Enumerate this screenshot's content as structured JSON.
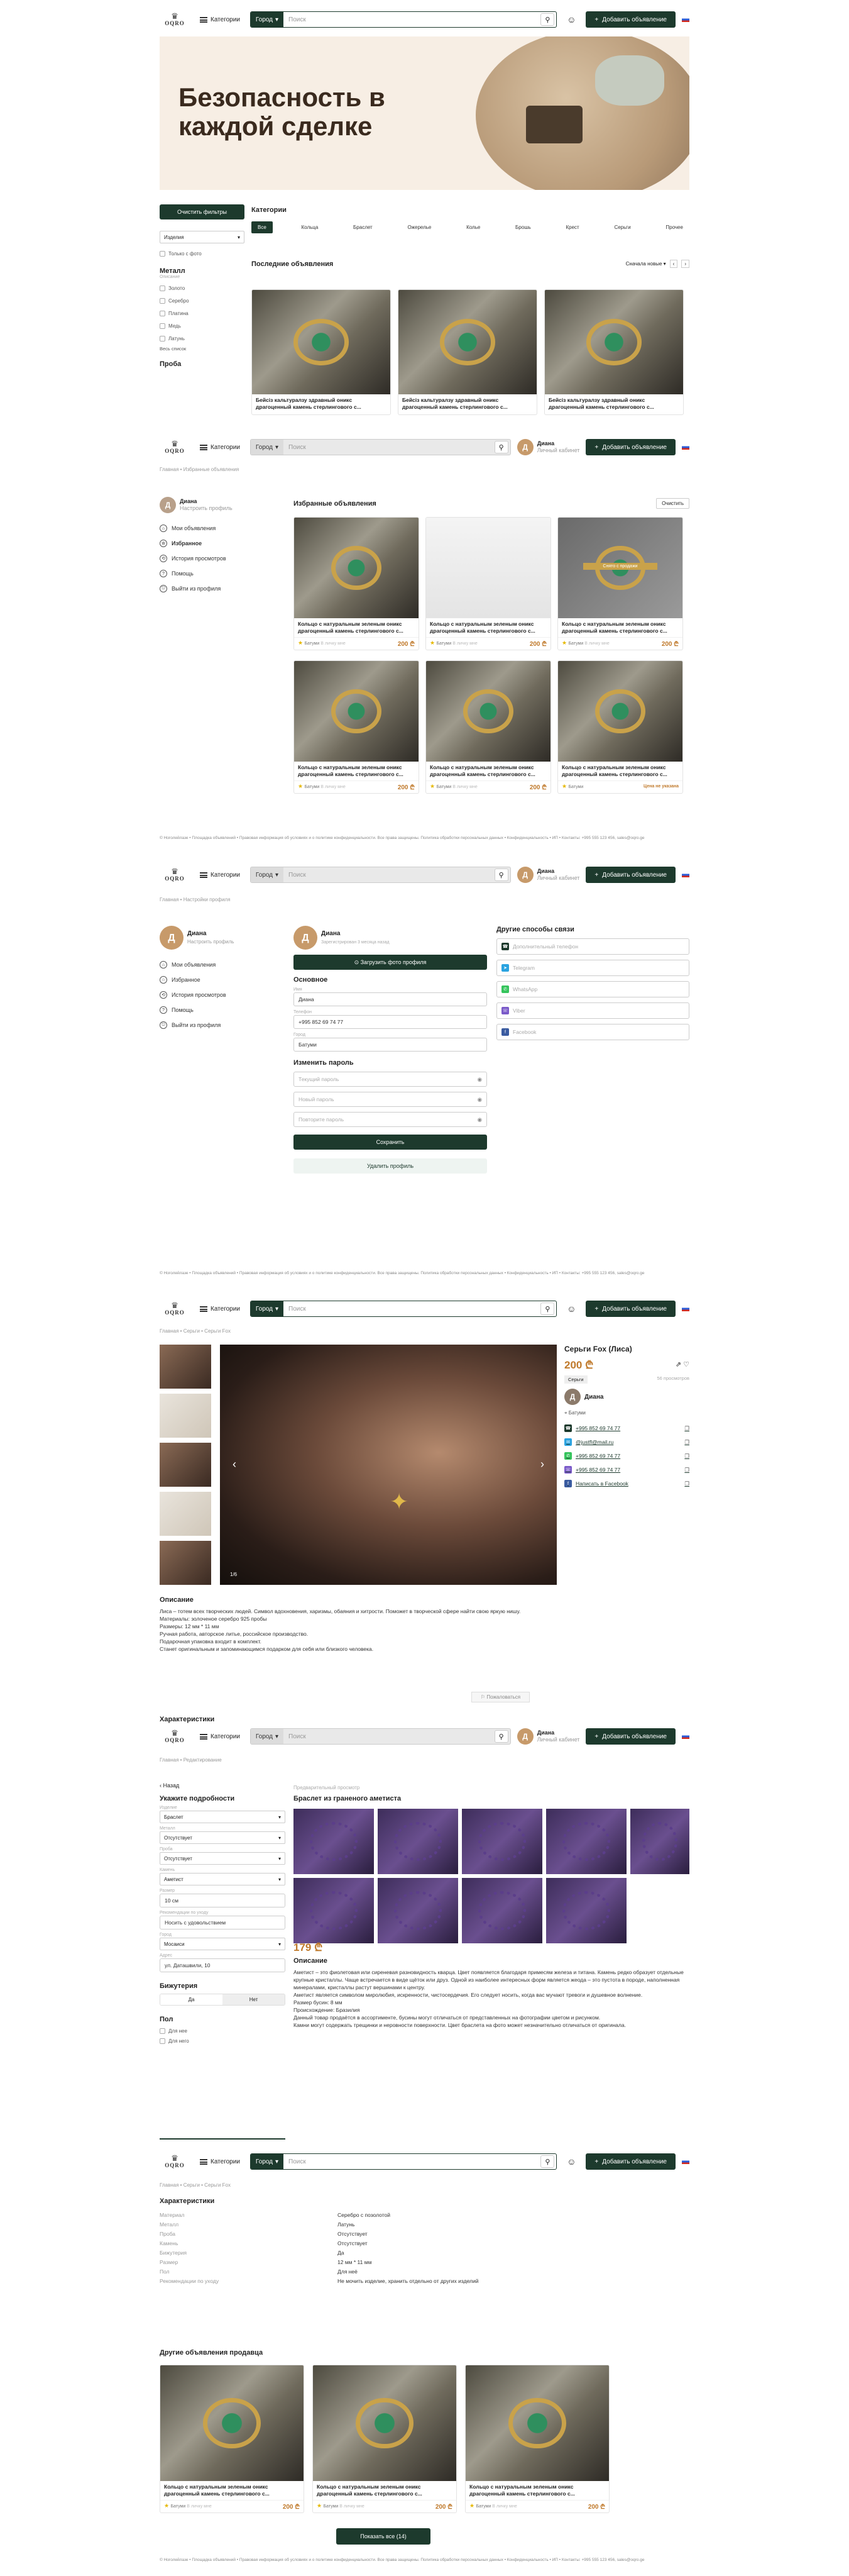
{
  "brand": {
    "logo": "OQRO"
  },
  "header": {
    "catalog": "Категории",
    "city": "Город",
    "search_placeholder": "Поиск",
    "add": "Добавить объявление",
    "profile_name": "Диана",
    "profile_sub": "Личный кабинет"
  },
  "home": {
    "banner": "Безопасность в каждой сделке",
    "clear_filters": "Очистить фильтры",
    "categories_title": "Категории",
    "tabs": [
      "Все",
      "Кольца",
      "Браслет",
      "Ожерелье",
      "Колье",
      "Брошь",
      "Крест",
      "Серьги",
      "Прочее"
    ],
    "sort_select": "Изделия",
    "only_photo": "Только с фото",
    "metal_title": "Металл",
    "metal_sub": "Описание",
    "metals": [
      "Золото",
      "Серебро",
      "Платина",
      "Медь",
      "Латунь"
    ],
    "all_list": "Весь список",
    "proba_title": "Проба",
    "latest_title": "Последние объявления",
    "sort": "Сначала новые",
    "card_title": "Бейсіз кальтуралзу здравный оникс драгоценный камень стерлингового с...",
    "pager": [
      "1",
      "2"
    ]
  },
  "favorites": {
    "crumb": "Главная  •  Избранные объявления",
    "user_name": "Диана",
    "user_sub": "Настроить профиль",
    "menu": [
      "Мои объявления",
      "Избранное",
      "История просмотров",
      "Помощь",
      "Выйти из профиля"
    ],
    "title": "Избранные объявления",
    "clear": "Очистить",
    "card_title": "Кольцо с натуральным зеленым оникс драгоценный камень стерлингового с...",
    "seller": "Батуми",
    "status": "В личку мне",
    "price": "200 ₾",
    "sold_label": "Снято с продажи",
    "sold_status": "Цена не указана"
  },
  "footer": {
    "text": "© Ноголейлазе  •  Площадка объявлений  •  Правовая информация об условиях и о политике конфиденциальности. Все права защищены. Политика обработки персональных данных  •  Конфиденциальность  •  ИП  •  Контакты: +995 555 123 456, sales@oqro.ge"
  },
  "settings": {
    "crumb": "Главная  •  Настройки профиля",
    "user_name": "Диана",
    "user_sub": "Настроить профиль",
    "profile_name": "Диана",
    "profile_sub": "Зарегистрирован 3 месяца назад",
    "upload": "Загрузить фото профиля",
    "basic": "Основное",
    "fields": [
      {
        "label": "Имя",
        "value": "Диана"
      },
      {
        "label": "Телефон",
        "value": "+995 852 69 74 77"
      },
      {
        "label": "Город",
        "value": "Батуми"
      }
    ],
    "password": "Изменить пароль",
    "pwd_fields": [
      "Текущий пароль",
      "Новый пароль",
      "Повторите пароль"
    ],
    "save": "Сохранить",
    "delete": "Удалить профиль",
    "other_title": "Другие способы связи",
    "others": [
      "Дополнительный телефон",
      "Telegram",
      "WhatsApp",
      "Viber",
      "Facebook"
    ]
  },
  "product": {
    "crumb": "Главная  •  Серьги  •  Серьги Fox",
    "title": "Серьги Fox (Лиса)",
    "price": "200 ₾",
    "tag": "Серьги",
    "views": "56 просмотров",
    "seller": "Диана",
    "city": "Батуми",
    "contacts": [
      "+995 852 69 74 77",
      "@justfl@mail.ru",
      "+995 852 69 74 77",
      "+995 852 69 74 77",
      "Написать в Facebook"
    ],
    "counter": "1/6",
    "desc_title": "Описание",
    "desc": [
      "Лиса – тотем всех творческих людей. Символ вдохновения, харизмы, обаяния и хитрости. Поможет в творческой сфере найти свою яркую нишу.",
      "Материалы: золоченое серебро 925 пробы",
      "Размеры: 12 мм * 11 мм",
      "Ручная работа, авторское литье, российское производство.",
      "Подарочная упаковка входит в комплект.",
      "Станет оригинальным и запоминающимся подарком для себя или близкого человека."
    ],
    "complain": "Пожаловаться",
    "chars_title": "Характеристики"
  },
  "edit": {
    "crumb": "Главная  •  Редактирование",
    "back": "Назад",
    "preview": "Предварительный просмотр",
    "specify": "Укажите подробности",
    "selects": [
      {
        "label": "Изделие",
        "value": "Браслет"
      },
      {
        "label": "Металл",
        "value": "Отсутствует"
      },
      {
        "label": "Проба",
        "value": "Отсутствует"
      },
      {
        "label": "Камень",
        "value": "Аметист"
      }
    ],
    "size_label": "Размер",
    "size": "10 см",
    "recommend_label": "Рекомендации по уходу",
    "recommend": "Носить с удовольствием",
    "city_label": "Город",
    "city": "Мосаиси",
    "address_label": "Адрес",
    "address": "ул. Даташвили, 10",
    "bijou_title": "Бижутерия",
    "bijou": [
      "Да",
      "Нет"
    ],
    "gender_title": "Пол",
    "gender": [
      "Для нее",
      "Для него"
    ],
    "ad_title": "Браслет из граненого аметиста",
    "price": "179 ₾",
    "desc_title": "Описание",
    "desc": [
      "Аметист – это фиолетовая или сиреневая разновидность кварца. Цвет появляется благодаря примесям железа и титана. Камень редко образует отдельные крупные кристаллы. Чаще встречается в виде щёток или друз. Одной из наиболее интересных форм является жеода – это пустота в породе, наполненная минералами, кристаллы растут вершинами к центру.",
      "Аметист является символом миролюбия, искренности, чистосердечия. Его следует носить, когда вас мучают тревоги и душевное волнение.",
      "Размер бусин: 8 мм",
      "Происхождение: Бразилия",
      "Данный товар продаётся в ассортименте, бусины могут отличаться от представленных на фотографии цветом и рисунком.",
      "Камни могут содержать трещинки и неровности поверхности. Цвет браслета на фото может незначительно отличаться от оригинала."
    ]
  },
  "chars": {
    "crumb": "Главная  •  Серьги  •  Серьги Fox",
    "title": "Характеристики",
    "rows": [
      {
        "k": "Материал",
        "v": "Серебро с позолотой"
      },
      {
        "k": "Металл",
        "v": "Латунь"
      },
      {
        "k": "Проба",
        "v": "Отсутствует"
      },
      {
        "k": "Камень",
        "v": "Отсутствует"
      },
      {
        "k": "Бижутерия",
        "v": "Да"
      },
      {
        "k": "Размер",
        "v": "12 мм * 11 мм"
      },
      {
        "k": "Пол",
        "v": "Для неё"
      },
      {
        "k": "Рекомендации по уходу",
        "v": "Не мочить изделие, хранить отдельно от других изделий"
      }
    ],
    "others_title": "Другие объявления продавца",
    "show_all": "Показать все (14)"
  }
}
